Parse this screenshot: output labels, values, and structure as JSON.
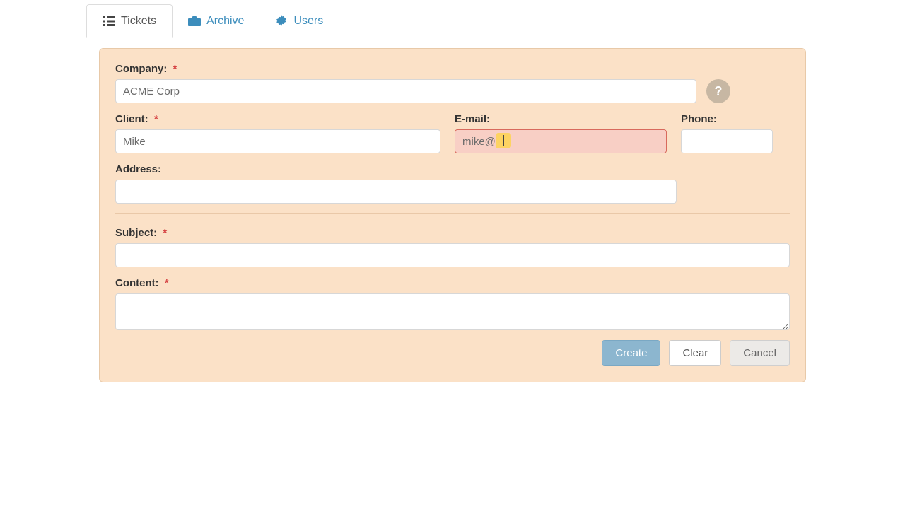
{
  "tabs": {
    "tickets": "Tickets",
    "archive": "Archive",
    "users": "Users"
  },
  "form": {
    "company": {
      "label": "Company:",
      "value": "ACME Corp"
    },
    "client": {
      "label": "Client:",
      "value": "Mike"
    },
    "email": {
      "label": "E-mail:",
      "value": "mike@"
    },
    "phone": {
      "label": "Phone:",
      "value": ""
    },
    "address": {
      "label": "Address:",
      "value": ""
    },
    "subject": {
      "label": "Subject:",
      "value": ""
    },
    "content": {
      "label": "Content:",
      "value": ""
    },
    "required_marker": "*",
    "help_tooltip": "?"
  },
  "buttons": {
    "create": "Create",
    "clear": "Clear",
    "cancel": "Cancel"
  }
}
